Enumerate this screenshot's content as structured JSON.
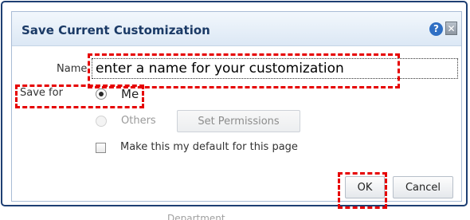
{
  "dialog": {
    "title": "Save Current Customization",
    "help_icon": "help-icon",
    "close_icon": "close-icon",
    "help_glyph": "?",
    "close_glyph": "✕"
  },
  "form": {
    "name_label": "Name",
    "name_placeholder": "enter a name for your customization",
    "name_value": "",
    "save_for_label": "Save for",
    "options": [
      {
        "label": "Me",
        "checked": true,
        "disabled": false
      },
      {
        "label": "Others",
        "checked": false,
        "disabled": true
      }
    ],
    "set_permissions_label": "Set Permissions",
    "default_label": "Make this my default for this page",
    "default_checked": false
  },
  "buttons": {
    "ok_label": "OK",
    "cancel_label": "Cancel"
  },
  "background": {
    "partial_text": "Department"
  },
  "colors": {
    "title": "#1b3a66",
    "frame": "#1e3f73",
    "highlight": "#e60000"
  }
}
